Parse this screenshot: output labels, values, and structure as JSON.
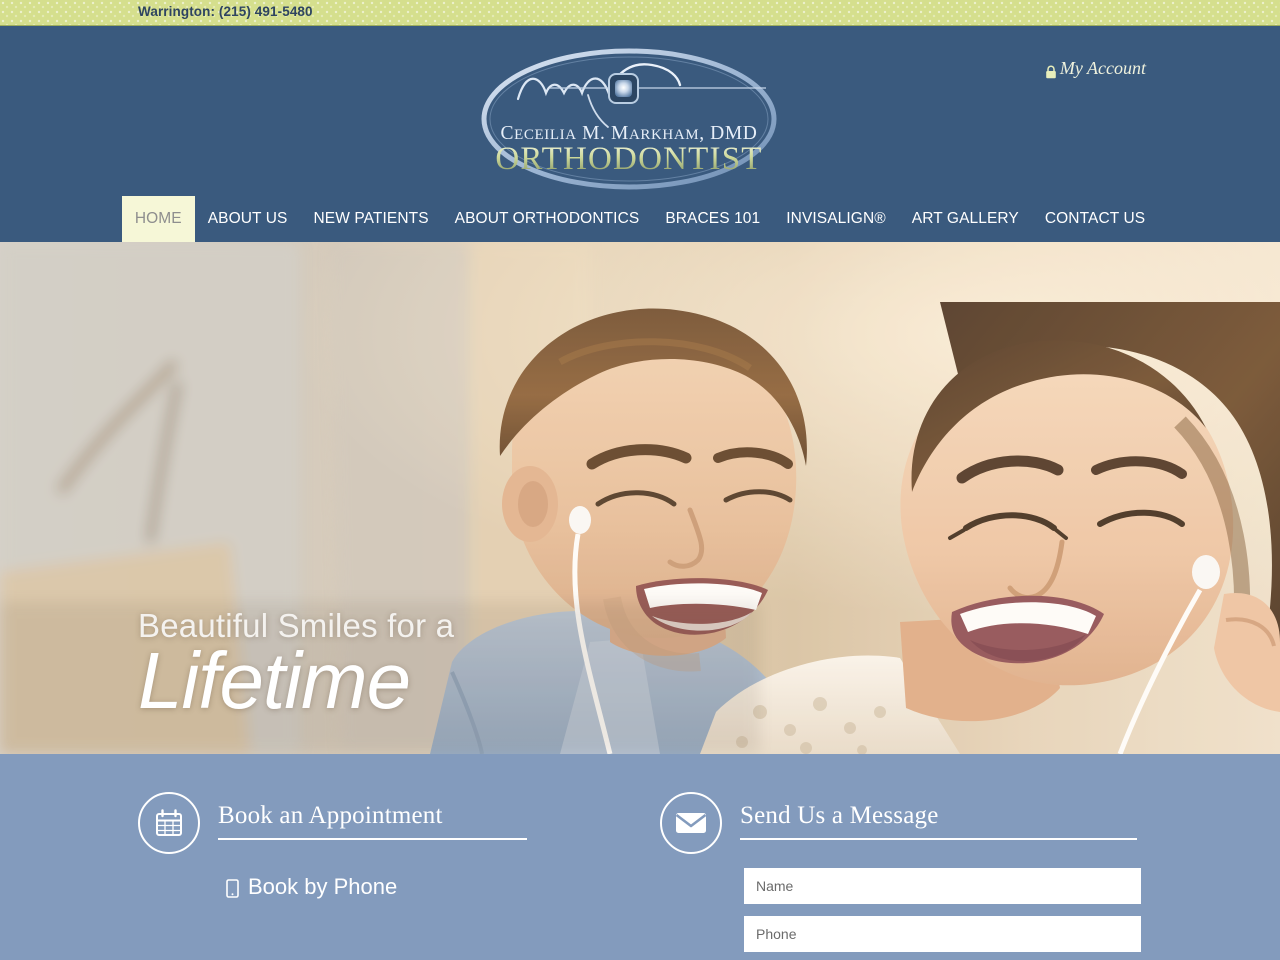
{
  "topbar": {
    "location_phone": "Warrington:  (215) 491-5480"
  },
  "header": {
    "account_label": "My Account",
    "lock_icon": "lock-icon",
    "logo": {
      "doctor_name": "Ceceilia M. Markham, DMD",
      "specialty": "ORTHODONTIST"
    }
  },
  "nav": {
    "items": [
      {
        "label": "HOME",
        "active": true
      },
      {
        "label": "ABOUT US",
        "active": false
      },
      {
        "label": "NEW PATIENTS",
        "active": false
      },
      {
        "label": "ABOUT ORTHODONTICS",
        "active": false
      },
      {
        "label": "BRACES 101",
        "active": false
      },
      {
        "label": "INVISALIGN®",
        "active": false
      },
      {
        "label": "ART GALLERY",
        "active": false
      },
      {
        "label": "CONTACT US",
        "active": false
      }
    ]
  },
  "hero": {
    "caption_line1": "Beautiful Smiles for a",
    "caption_line2": "Lifetime",
    "image_alt": "Smiling young couple sharing earbuds outdoors"
  },
  "panel": {
    "appointment": {
      "icon": "calendar-icon",
      "title": "Book an Appointment",
      "book_by_phone_label": "Book by Phone",
      "book_by_phone_icon": "mobile-phone-icon"
    },
    "message": {
      "icon": "envelope-icon",
      "title": "Send Us a Message",
      "fields": [
        {
          "name": "name",
          "placeholder": "Name",
          "value": ""
        },
        {
          "name": "phone",
          "placeholder": "Phone",
          "value": ""
        }
      ]
    }
  },
  "colors": {
    "topbar_green": "#d5df8d",
    "header_navy": "#3a5a7e",
    "panel_blue": "#839bbd",
    "nav_active_bg": "#f6f7d7",
    "white": "#ffffff"
  }
}
